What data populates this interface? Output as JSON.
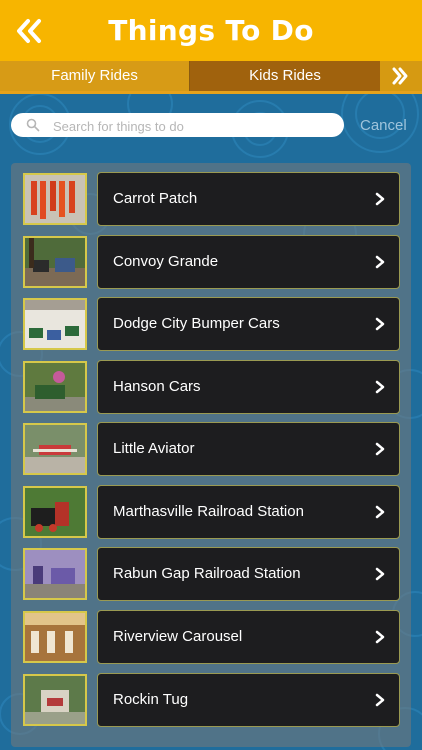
{
  "header": {
    "title": "Things To Do",
    "back_icon": "double-chevron-left-icon",
    "bg": "#f7b500"
  },
  "tabs": {
    "items": [
      {
        "label": "Family Rides",
        "selected": false
      },
      {
        "label": "Kids Rides",
        "selected": true
      }
    ],
    "next_icon": "double-chevron-right-icon"
  },
  "search": {
    "placeholder": "Search for things to do",
    "value": "",
    "cancel_label": "Cancel",
    "icon": "search-icon"
  },
  "list": {
    "chevron_icon": "chevron-right-icon",
    "items": [
      {
        "label": "Carrot Patch",
        "thumb": "carrot-patch-photo"
      },
      {
        "label": "Convoy Grande",
        "thumb": "convoy-grande-photo"
      },
      {
        "label": "Dodge City Bumper Cars",
        "thumb": "bumper-cars-photo"
      },
      {
        "label": "Hanson Cars",
        "thumb": "hanson-cars-photo"
      },
      {
        "label": "Little Aviator",
        "thumb": "little-aviator-photo"
      },
      {
        "label": "Marthasville Railroad Station",
        "thumb": "marthasville-railroad-photo"
      },
      {
        "label": "Rabun Gap Railroad Station",
        "thumb": "rabun-gap-railroad-photo"
      },
      {
        "label": "Riverview Carousel",
        "thumb": "riverview-carousel-photo"
      },
      {
        "label": "Rockin Tug",
        "thumb": "rockin-tug-photo"
      }
    ]
  }
}
